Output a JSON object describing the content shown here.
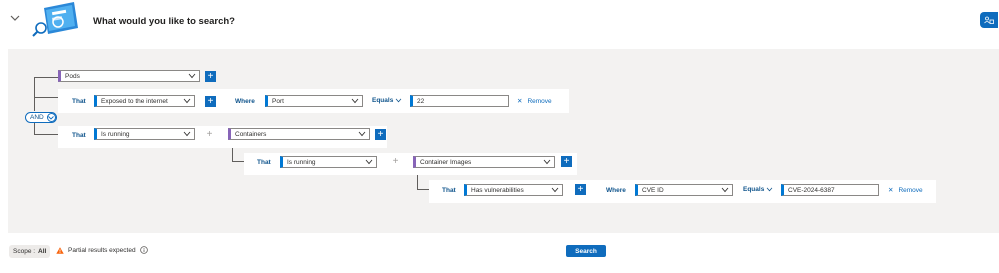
{
  "header": {
    "title": "What would you like to search?"
  },
  "builder": {
    "and_label": "AND",
    "root": {
      "resource": "Pods"
    },
    "row1": {
      "that": "That",
      "relation": "Exposed to the internet",
      "where": "Where",
      "property": "Port",
      "operator": "Equals",
      "value": "22",
      "remove": "Remove"
    },
    "row2": {
      "that": "That",
      "relation": "Is running",
      "target": "Containers"
    },
    "row3": {
      "that": "That",
      "relation": "Is running",
      "target": "Container Images"
    },
    "row4": {
      "that": "That",
      "relation": "Has vulnerabilities",
      "where": "Where",
      "property": "CVE ID",
      "operator": "Equals",
      "value": "CVE-2024-6387",
      "remove": "Remove"
    }
  },
  "footer": {
    "scope_label": "Scope :",
    "scope_value": "All",
    "warning": "Partial results expected",
    "search_label": "Search"
  },
  "colors": {
    "accent": "#0f6cbd",
    "purple": "#8764b8",
    "canvas": "#f3f2f1"
  }
}
